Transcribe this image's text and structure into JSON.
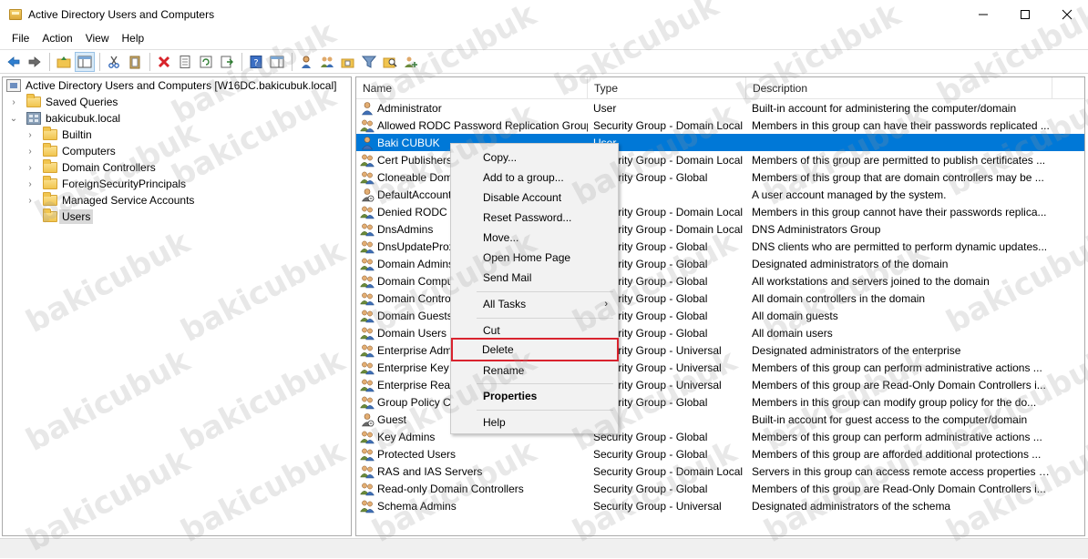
{
  "window": {
    "title": "Active Directory Users and Computers"
  },
  "menubar": [
    "File",
    "Action",
    "View",
    "Help"
  ],
  "tree": {
    "root": "Active Directory Users and Computers [W16DC.bakicubuk.local]",
    "saved_queries": "Saved Queries",
    "domain": "bakicubuk.local",
    "children": [
      "Builtin",
      "Computers",
      "Domain Controllers",
      "ForeignSecurityPrincipals",
      "Managed Service Accounts",
      "Users"
    ]
  },
  "columns": {
    "name": "Name",
    "type": "Type",
    "description": "Description"
  },
  "rows": [
    {
      "name": "Administrator",
      "type": "User",
      "desc": "Built-in account for administering the computer/domain",
      "icon": "user"
    },
    {
      "name": "Allowed RODC Password Replication Group",
      "type": "Security Group - Domain Local",
      "desc": "Members in this group can have their passwords replicated ...",
      "icon": "group"
    },
    {
      "name": "Baki CUBUK",
      "type": "User",
      "desc": "",
      "icon": "user"
    },
    {
      "name": "Cert Publishers",
      "type": "Security Group - Domain Local",
      "desc": "Members of this group are permitted to publish certificates ...",
      "icon": "group"
    },
    {
      "name": "Cloneable Domain Controllers",
      "type": "Security Group - Global",
      "desc": "Members of this group that are domain controllers may be ...",
      "icon": "group"
    },
    {
      "name": "DefaultAccount",
      "type": "",
      "desc": "A user account managed by the system.",
      "icon": "user-disabled"
    },
    {
      "name": "Denied RODC Password Replication Group",
      "type": "Security Group - Domain Local",
      "desc": "Members in this group cannot have their passwords replica...",
      "icon": "group"
    },
    {
      "name": "DnsAdmins",
      "type": "Security Group - Domain Local",
      "desc": "DNS Administrators Group",
      "icon": "group"
    },
    {
      "name": "DnsUpdateProxy",
      "type": "Security Group - Global",
      "desc": "DNS clients who are permitted to perform dynamic updates...",
      "icon": "group"
    },
    {
      "name": "Domain Admins",
      "type": "Security Group - Global",
      "desc": "Designated administrators of the domain",
      "icon": "group"
    },
    {
      "name": "Domain Computers",
      "type": "Security Group - Global",
      "desc": "All workstations and servers joined to the domain",
      "icon": "group"
    },
    {
      "name": "Domain Controllers",
      "type": "Security Group - Global",
      "desc": "All domain controllers in the domain",
      "icon": "group"
    },
    {
      "name": "Domain Guests",
      "type": "Security Group - Global",
      "desc": "All domain guests",
      "icon": "group"
    },
    {
      "name": "Domain Users",
      "type": "Security Group - Global",
      "desc": "All domain users",
      "icon": "group"
    },
    {
      "name": "Enterprise Admins",
      "type": "Security Group - Universal",
      "desc": "Designated administrators of the enterprise",
      "icon": "group"
    },
    {
      "name": "Enterprise Key Admins",
      "type": "Security Group - Universal",
      "desc": "Members of this group can perform administrative actions ...",
      "icon": "group"
    },
    {
      "name": "Enterprise Read-only Domain Controllers",
      "type": "Security Group - Universal",
      "desc": "Members of this group are Read-Only Domain Controllers i...",
      "icon": "group"
    },
    {
      "name": "Group Policy Creator Owners",
      "type": "Security Group - Global",
      "desc": "Members in this group can modify group policy for the do...",
      "icon": "group"
    },
    {
      "name": "Guest",
      "type": "",
      "desc": "Built-in account for guest access to the computer/domain",
      "icon": "user-disabled"
    },
    {
      "name": "Key Admins",
      "type": "Security Group - Global",
      "desc": "Members of this group can perform administrative actions ...",
      "icon": "group"
    },
    {
      "name": "Protected Users",
      "type": "Security Group - Global",
      "desc": "Members of this group are afforded additional protections ...",
      "icon": "group"
    },
    {
      "name": "RAS and IAS Servers",
      "type": "Security Group - Domain Local",
      "desc": "Servers in this group can access remote access properties of...",
      "icon": "group"
    },
    {
      "name": "Read-only Domain Controllers",
      "type": "Security Group - Global",
      "desc": "Members of this group are Read-Only Domain Controllers i...",
      "icon": "group"
    },
    {
      "name": "Schema Admins",
      "type": "Security Group - Universal",
      "desc": "Designated administrators of the schema",
      "icon": "group"
    }
  ],
  "selected_row_index": 2,
  "context_menu": {
    "copy": "Copy...",
    "add_to_group": "Add to a group...",
    "disable_account": "Disable Account",
    "reset_password": "Reset Password...",
    "move": "Move...",
    "open_home_page": "Open Home Page",
    "send_mail": "Send Mail",
    "all_tasks": "All Tasks",
    "cut": "Cut",
    "delete": "Delete",
    "rename": "Rename",
    "properties": "Properties",
    "help": "Help",
    "submenu_glyph": "›"
  },
  "watermark": "bakicubuk",
  "colors": {
    "selection": "#0078d7",
    "highlight_box": "#d9232e",
    "tree_selected": "#d9d9d9"
  }
}
